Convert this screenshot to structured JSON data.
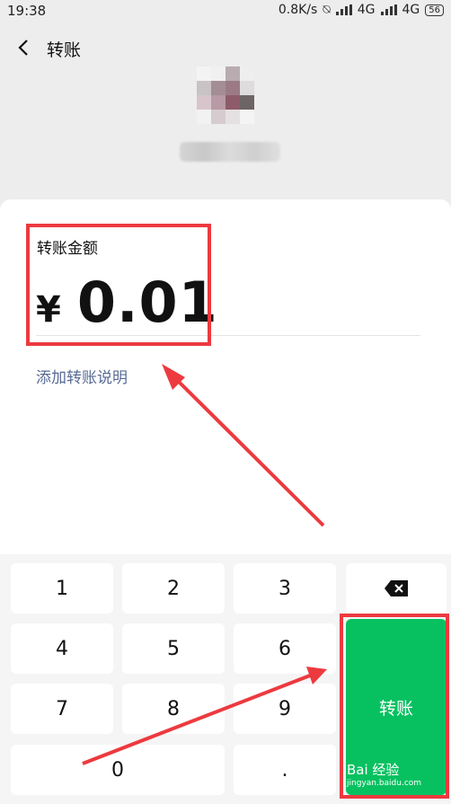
{
  "status_bar": {
    "time": "19:38",
    "net_speed": "0.8K/s",
    "network_1": "4G",
    "network_2": "4G",
    "battery": "56"
  },
  "header": {
    "back_icon": "chevron-left-icon",
    "title": "转账"
  },
  "transfer": {
    "amount_label": "转账金额",
    "currency_symbol": "¥",
    "amount": "0.01",
    "add_note_link": "添加转账说明"
  },
  "keypad": {
    "keys": [
      "1",
      "2",
      "3",
      "4",
      "5",
      "6",
      "7",
      "8",
      "9",
      "0",
      "."
    ],
    "delete_icon": "backspace-icon",
    "confirm_label": "转账"
  },
  "watermark": {
    "brand": "Bai 经验",
    "url": "jingyan.baidu.com"
  },
  "colors": {
    "accent_green": "#07c160",
    "link_blue": "#576b95",
    "annotation_red": "#ec3a3f"
  }
}
